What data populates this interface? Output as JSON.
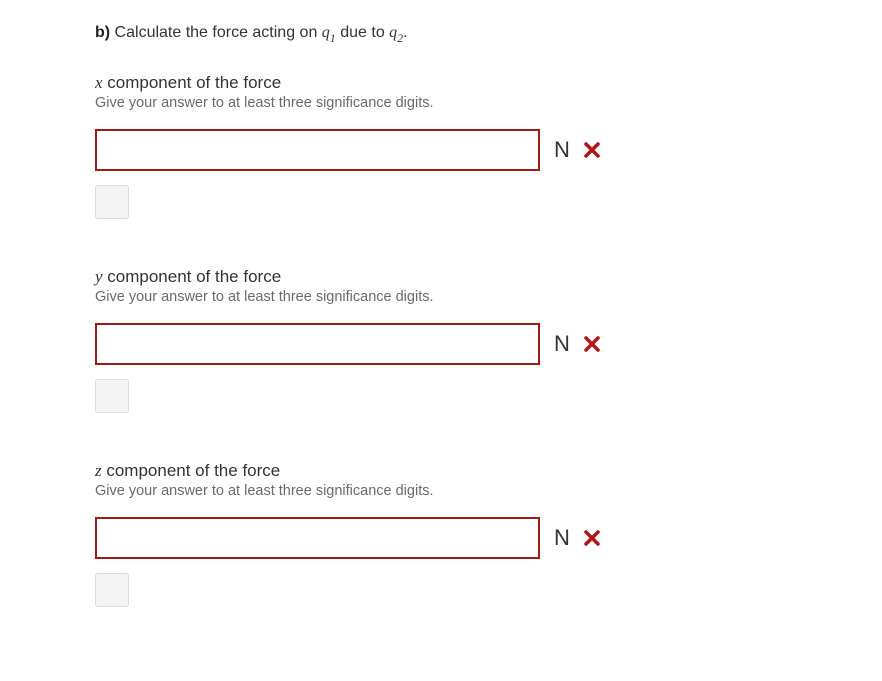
{
  "prompt": {
    "part_label": "b)",
    "text_before": " Calculate the force acting on ",
    "q1": "q",
    "q1_sub": "1",
    "text_mid": " due to ",
    "q2": "q",
    "q2_sub": "2",
    "text_after": "."
  },
  "questions": [
    {
      "var": "x",
      "title_rest": " component of the force",
      "hint": "Give your answer to at least three significance digits.",
      "value": "",
      "unit": "N",
      "status": "incorrect"
    },
    {
      "var": "y",
      "title_rest": " component of the force",
      "hint": "Give your answer to at least three significance digits.",
      "value": "",
      "unit": "N",
      "status": "incorrect"
    },
    {
      "var": "z",
      "title_rest": " component of the force",
      "hint": "Give your answer to at least three significance digits.",
      "value": "",
      "unit": "N",
      "status": "incorrect"
    }
  ]
}
